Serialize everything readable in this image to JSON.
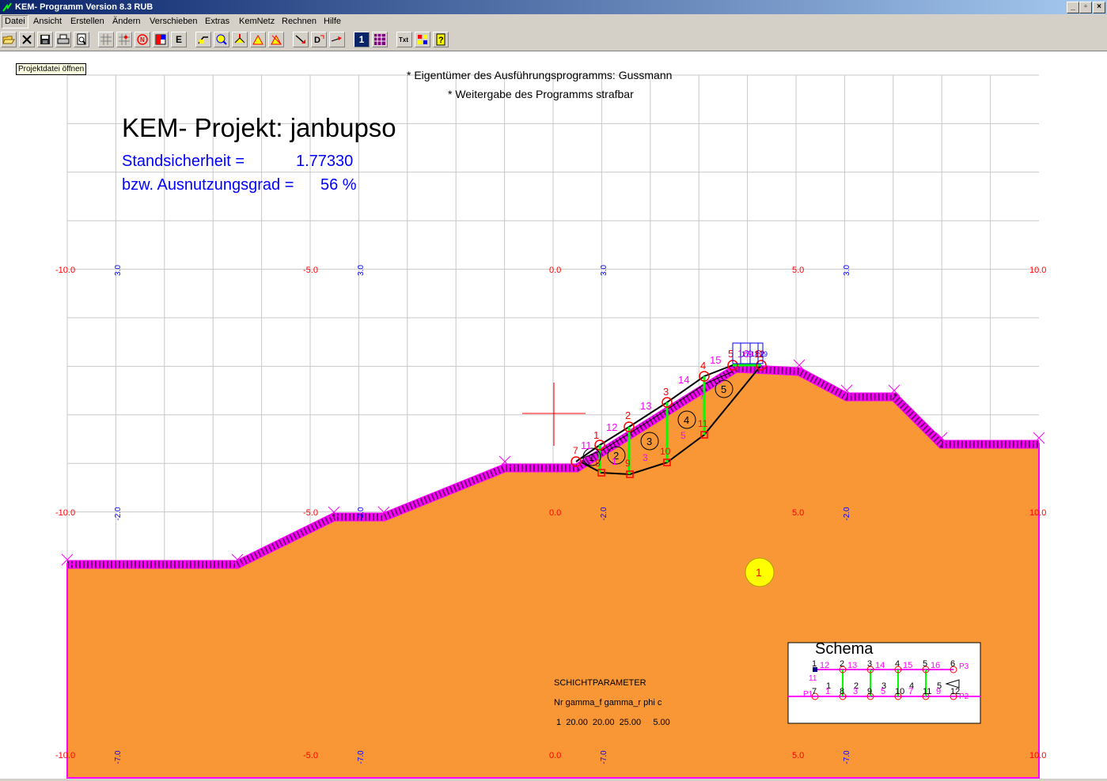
{
  "window": {
    "title": "KEM- Programm Version 8.3 RUB",
    "min_label": "_",
    "max_label": "▫",
    "close_label": "×"
  },
  "menu": {
    "items": [
      "Datei",
      "Ansicht",
      "Erstellen",
      "Ändern",
      "Verschieben",
      "Extras",
      "KemNetz",
      "Rechnen",
      "Hilfe"
    ]
  },
  "toolbar": {
    "tooltip": "Projektdatei öffnen",
    "labels": {
      "n": "N",
      "e": "E",
      "d": "D",
      "one": "1",
      "txt": "Txt"
    }
  },
  "colors": {
    "soil": "#f99737",
    "surface_band": "#ff00ff",
    "grid": "#c8c8c8",
    "axis_red": "#ff0000",
    "axis_blue": "#0000ff",
    "slice_green": "#00ff00",
    "soil_marker": "#ffff00"
  },
  "header": {
    "line1": "* Eigentümer des Ausführungsprogramms: Gussmann",
    "line2": "* Weitergabe des Programms strafbar"
  },
  "project": {
    "title": "KEM- Projekt: janbupso",
    "safety_label": "Standsicherheit =",
    "safety_value": "1.77330",
    "util_label": "bzw. Ausnutzungsgrad =",
    "util_value": "56 %"
  },
  "axes": {
    "x_ticks_red": [
      "-10.0",
      "-5.0",
      "0.0",
      "5.0",
      "10.0"
    ],
    "y_ticks_blue_top": [
      "3.0",
      "3.0",
      "3.0",
      "3.0"
    ],
    "y_ticks_blue_mid": [
      "-2.0",
      "-2.0",
      "-2.0",
      "-2.0"
    ],
    "y_ticks_blue_bot": [
      "-7.0",
      "-7.0",
      "-7.0",
      "-7.0"
    ]
  },
  "slices": {
    "body_numbers": [
      "1",
      "2",
      "3",
      "4",
      "5"
    ],
    "top_nodes": [
      "1",
      "2",
      "3",
      "4",
      "5",
      "6"
    ],
    "top_mid": [
      "11",
      "12",
      "13",
      "14",
      "15",
      "16"
    ],
    "bottom_nodes": [
      "7",
      "8",
      "9",
      "10",
      "11",
      "12"
    ],
    "bottom_mid": [
      "1",
      "3",
      "5",
      "7",
      "9"
    ],
    "top_edge_labels": [
      "17",
      "18",
      "19"
    ]
  },
  "soil_layer": {
    "id": "1"
  },
  "layer_params": {
    "title": "SCHICHTPARAMETER",
    "columns": "Nr gamma_f gamma_r phi c",
    "row": " 1  20.00  20.00  25.00     5.00"
  },
  "schema": {
    "title": "Schema",
    "top_nodes": [
      "1",
      "2",
      "3",
      "4",
      "5",
      "6"
    ],
    "top_mid": [
      "12",
      "13",
      "14",
      "15",
      "16"
    ],
    "bottom_nodes": [
      "7",
      "8",
      "9",
      "10",
      "11",
      "12"
    ],
    "bottom_mid": [
      "1",
      "3",
      "5",
      "7",
      "9"
    ],
    "body": [
      "1",
      "2",
      "3",
      "4",
      "5"
    ],
    "points": [
      "P1",
      "P2",
      "P3"
    ],
    "side_label": "11"
  }
}
